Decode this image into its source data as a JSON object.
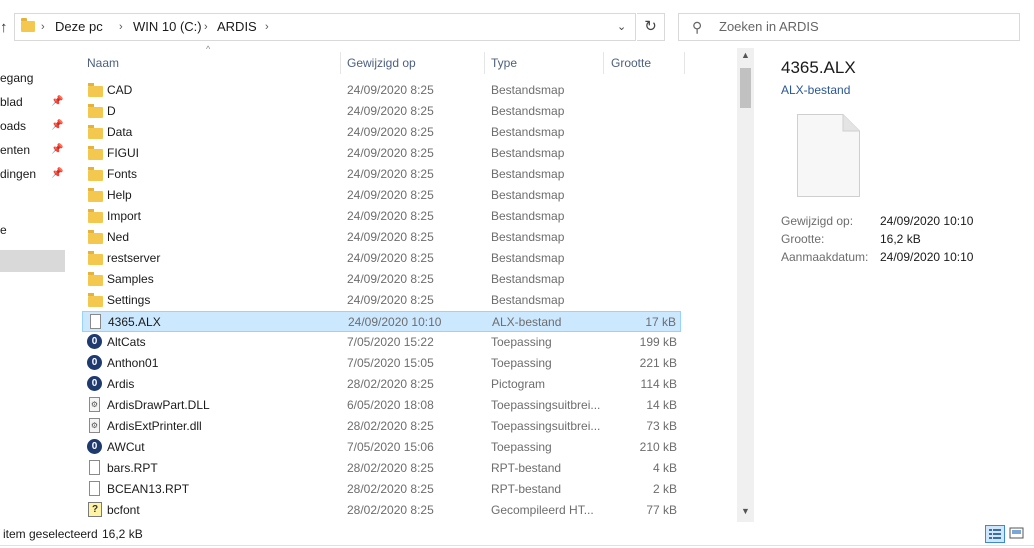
{
  "address": {
    "crumbs": [
      "Deze pc",
      "WIN 10 (C:)",
      "ARDIS"
    ],
    "search_placeholder": "Zoeken in ARDIS"
  },
  "nav": {
    "items": [
      "egang",
      "blad",
      "oads",
      "enten",
      "dingen",
      "e"
    ]
  },
  "columns": {
    "name": "Naam",
    "date": "Gewijzigd op",
    "type": "Type",
    "size": "Grootte"
  },
  "files": [
    {
      "name": "CAD",
      "date": "24/09/2020 8:25",
      "type": "Bestandsmap",
      "size": "",
      "icon": "folder-icon"
    },
    {
      "name": "D",
      "date": "24/09/2020 8:25",
      "type": "Bestandsmap",
      "size": "",
      "icon": "folder-icon"
    },
    {
      "name": "Data",
      "date": "24/09/2020 8:25",
      "type": "Bestandsmap",
      "size": "",
      "icon": "folder-icon"
    },
    {
      "name": "FIGUI",
      "date": "24/09/2020 8:25",
      "type": "Bestandsmap",
      "size": "",
      "icon": "folder-icon"
    },
    {
      "name": "Fonts",
      "date": "24/09/2020 8:25",
      "type": "Bestandsmap",
      "size": "",
      "icon": "folder-icon"
    },
    {
      "name": "Help",
      "date": "24/09/2020 8:25",
      "type": "Bestandsmap",
      "size": "",
      "icon": "folder-icon"
    },
    {
      "name": "Import",
      "date": "24/09/2020 8:25",
      "type": "Bestandsmap",
      "size": "",
      "icon": "folder-icon"
    },
    {
      "name": "Ned",
      "date": "24/09/2020 8:25",
      "type": "Bestandsmap",
      "size": "",
      "icon": "folder-icon"
    },
    {
      "name": "restserver",
      "date": "24/09/2020 8:25",
      "type": "Bestandsmap",
      "size": "",
      "icon": "folder-icon"
    },
    {
      "name": "Samples",
      "date": "24/09/2020 8:25",
      "type": "Bestandsmap",
      "size": "",
      "icon": "folder-icon"
    },
    {
      "name": "Settings",
      "date": "24/09/2020 8:25",
      "type": "Bestandsmap",
      "size": "",
      "icon": "folder-icon"
    },
    {
      "name": "4365.ALX",
      "date": "24/09/2020 10:10",
      "type": "ALX-bestand",
      "size": "17 kB",
      "icon": "file-icon",
      "selected": true
    },
    {
      "name": "AltCats",
      "date": "7/05/2020 15:22",
      "type": "Toepassing",
      "size": "199 kB",
      "icon": "app-icon"
    },
    {
      "name": "Anthon01",
      "date": "7/05/2020 15:05",
      "type": "Toepassing",
      "size": "221 kB",
      "icon": "app-icon"
    },
    {
      "name": "Ardis",
      "date": "28/02/2020 8:25",
      "type": "Pictogram",
      "size": "114 kB",
      "icon": "app-icon"
    },
    {
      "name": "ArdisDrawPart.DLL",
      "date": "6/05/2020 18:08",
      "type": "Toepassingsuitbrei...",
      "size": "14 kB",
      "icon": "dll-icon"
    },
    {
      "name": "ArdisExtPrinter.dll",
      "date": "28/02/2020 8:25",
      "type": "Toepassingsuitbrei...",
      "size": "73 kB",
      "icon": "dll-icon"
    },
    {
      "name": "AWCut",
      "date": "7/05/2020 15:06",
      "type": "Toepassing",
      "size": "210 kB",
      "icon": "app-icon"
    },
    {
      "name": "bars.RPT",
      "date": "28/02/2020 8:25",
      "type": "RPT-bestand",
      "size": "4 kB",
      "icon": "file-icon"
    },
    {
      "name": "BCEAN13.RPT",
      "date": "28/02/2020 8:25",
      "type": "RPT-bestand",
      "size": "2 kB",
      "icon": "file-icon"
    },
    {
      "name": "bcfont",
      "date": "28/02/2020 8:25",
      "type": "Gecompileerd HT...",
      "size": "77 kB",
      "icon": "help-file-icon"
    }
  ],
  "preview": {
    "title": "4365.ALX",
    "subtitle": "ALX-bestand",
    "props": [
      {
        "label": "Gewijzigd op:",
        "value": "24/09/2020 10:10"
      },
      {
        "label": "Grootte:",
        "value": "16,2 kB"
      },
      {
        "label": "Aanmaakdatum:",
        "value": "24/09/2020 10:10"
      }
    ]
  },
  "status": {
    "text": "item geselecteerd",
    "size": "16,2 kB"
  },
  "colors": {
    "selection": "#cce8ff",
    "selection_border": "#99d1ff",
    "folder": "#f4c84f",
    "app": "#1e3a6e"
  }
}
